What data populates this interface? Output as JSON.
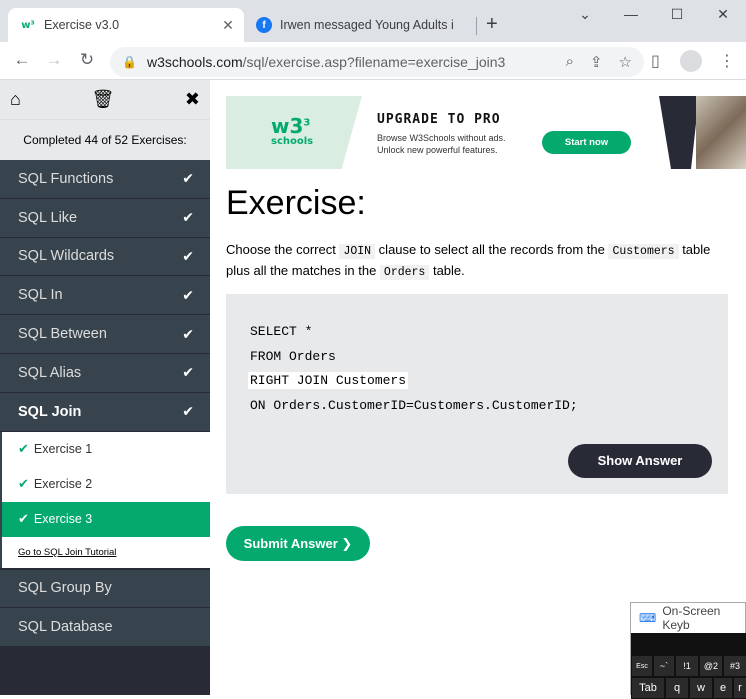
{
  "browser": {
    "tabs": [
      {
        "title": "Exercise v3.0",
        "favicon": "w3-logo-icon",
        "active": true
      },
      {
        "title": "Irwen messaged Young Adults i",
        "favicon": "facebook-icon",
        "active": false
      }
    ],
    "new_tab": "+",
    "window_controls": {
      "chevron": "⌄",
      "minimize": "—",
      "maximize": "☐",
      "close": "✕"
    },
    "url_host": "w3schools.com",
    "url_path": "/sql/exercise.asp?filename=exercise_join3"
  },
  "sidebar": {
    "progress_text": "Completed 44 of 52 Exercises:",
    "items_before": [
      {
        "label": "SQL Functions",
        "done": true
      },
      {
        "label": "SQL Like",
        "done": true
      },
      {
        "label": "SQL Wildcards",
        "done": true
      },
      {
        "label": "SQL In",
        "done": true
      },
      {
        "label": "SQL Between",
        "done": true
      },
      {
        "label": "SQL Alias",
        "done": true
      },
      {
        "label": "SQL Join",
        "done": true
      }
    ],
    "sub_items": [
      {
        "label": "Exercise 1"
      },
      {
        "label": "Exercise 2"
      },
      {
        "label": "Exercise 3"
      }
    ],
    "tutorial_link": "Go to SQL Join Tutorial",
    "items_after": [
      {
        "label": "SQL Group By"
      },
      {
        "label": "SQL Database"
      }
    ]
  },
  "ad": {
    "logo": "w3",
    "logo_sup": "3",
    "logo_sub": "schools",
    "heading": "UPGRADE TO PRO",
    "line1": "Browse W3Schools without ads.",
    "line2": "Unlock new powerful features.",
    "button": "Start now"
  },
  "exercise": {
    "title": "Exercise:",
    "desc_1": "Choose the correct ",
    "code_1": "JOIN",
    "desc_2": " clause to select all the records from the ",
    "code_2": "Customers",
    "desc_3": " table plus all the matches in the ",
    "code_3": "Orders",
    "desc_4": " table.",
    "code_lines": {
      "line1": "SELECT *",
      "line2": "FROM Orders",
      "answer": "RIGHT JOIN Customers",
      "line4": "ON Orders.CustomerID=Customers.CustomerID;"
    },
    "show_answer": "Show Answer",
    "submit": "Submit Answer ❯"
  },
  "osk": {
    "title": "On-Screen Keyb",
    "keys": [
      "Esc",
      "~`",
      "!1",
      "@2",
      "#3",
      "Tab",
      "q",
      "w",
      "e",
      "r"
    ]
  }
}
